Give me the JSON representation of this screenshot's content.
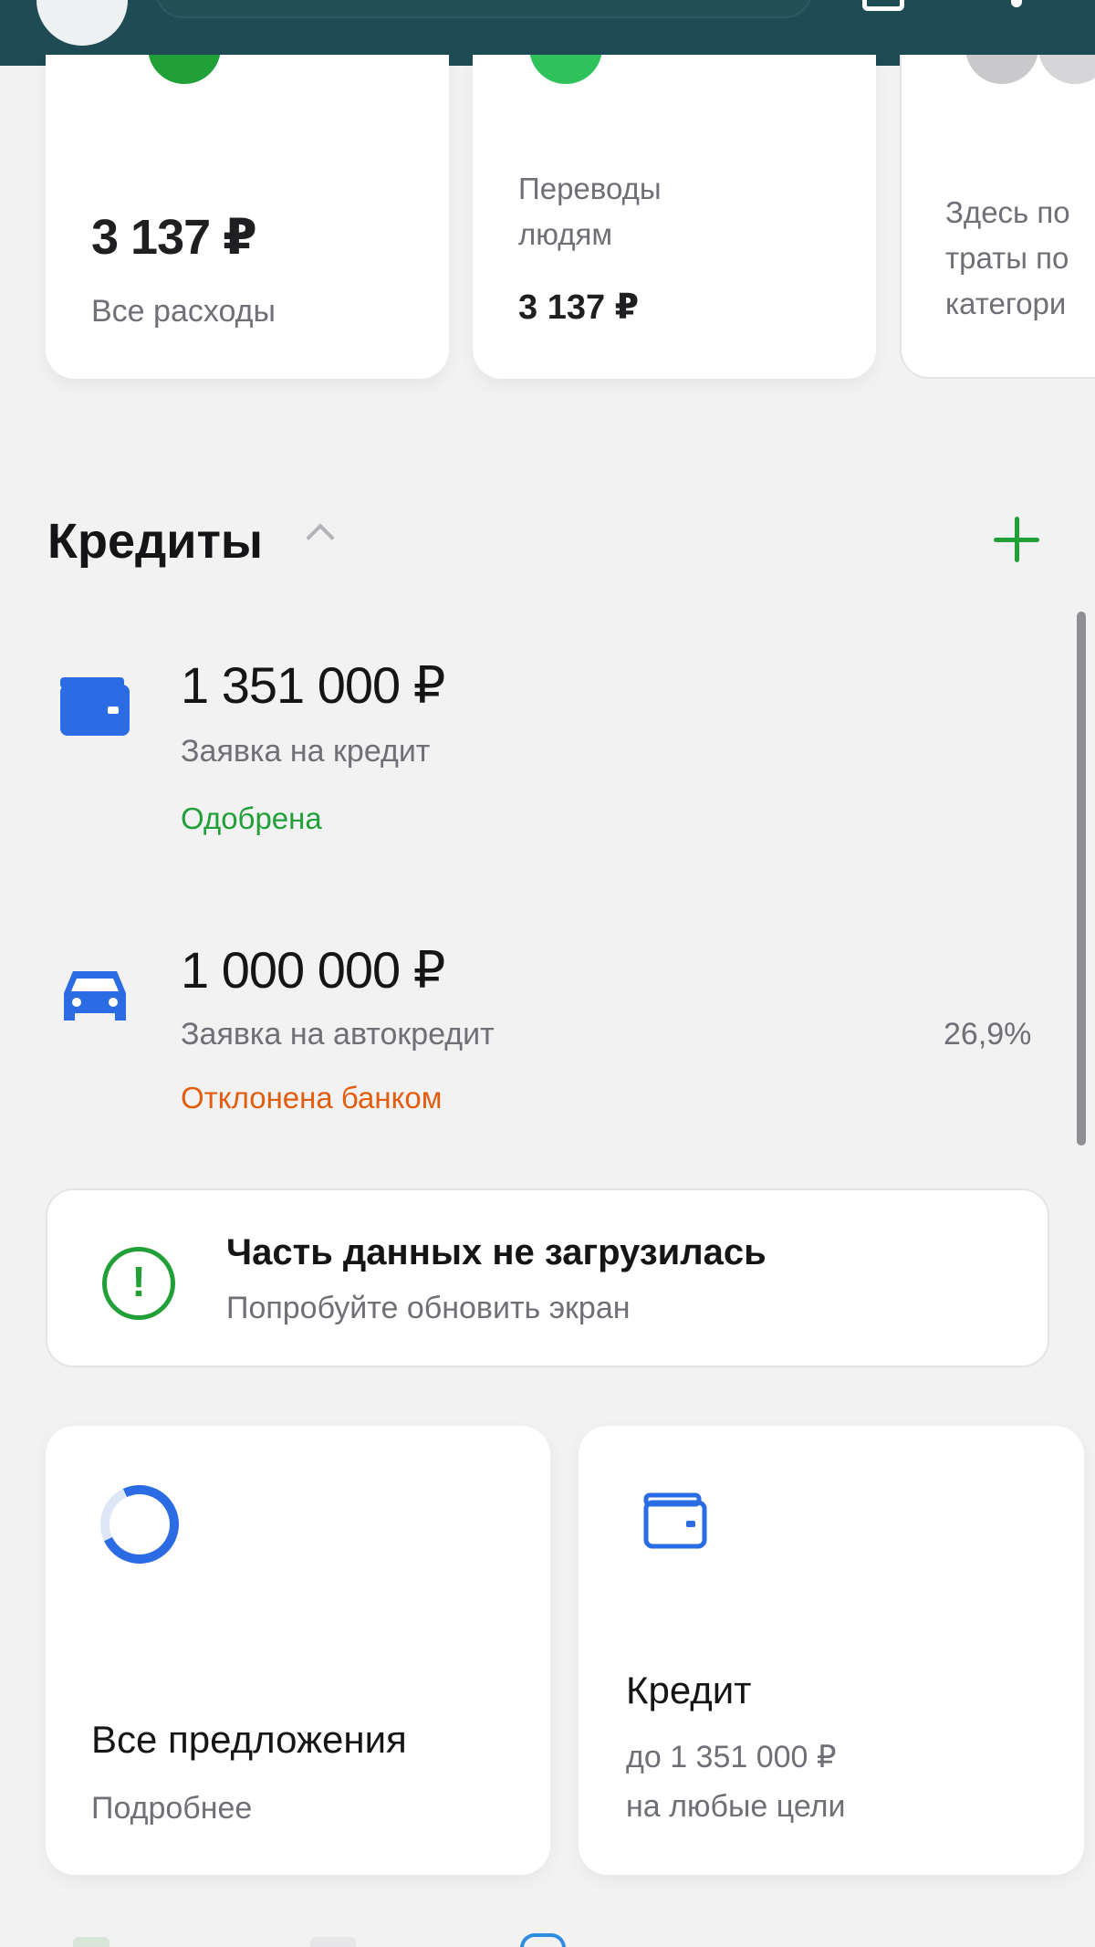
{
  "summary": {
    "all_expenses": {
      "amount": "3 137 ₽",
      "label": "Все расходы"
    },
    "transfers": {
      "title": "Переводы\nлюдям",
      "amount": "3 137 ₽"
    },
    "placeholder_card": {
      "text": "Здесь по\nтраты по\nкатегори"
    }
  },
  "credits": {
    "title": "Кредиты",
    "items": [
      {
        "amount": "1 351 000 ₽",
        "description": "Заявка на кредит",
        "status": "Одобрена",
        "status_color": "#21a038",
        "icon": "wallet-icon"
      },
      {
        "amount": "1 000 000 ₽",
        "description": "Заявка на автокредит",
        "status": "Отклонена банком",
        "status_color": "#e35d0f",
        "rate": "26,9%",
        "icon": "car-icon"
      }
    ]
  },
  "warning": {
    "title": "Часть данных не загрузилась",
    "subtitle": "Попробуйте обновить экран"
  },
  "offers": {
    "all": {
      "title": "Все предложения",
      "link": "Подробнее"
    },
    "credit": {
      "title": "Кредит",
      "subtitle": "до 1 351 000 ₽\nна любые цели"
    }
  },
  "colors": {
    "accent_green": "#21a038",
    "icon_blue": "#2b6be3",
    "header_bg": "#1f4c54",
    "rejected_orange": "#e35d0f"
  }
}
